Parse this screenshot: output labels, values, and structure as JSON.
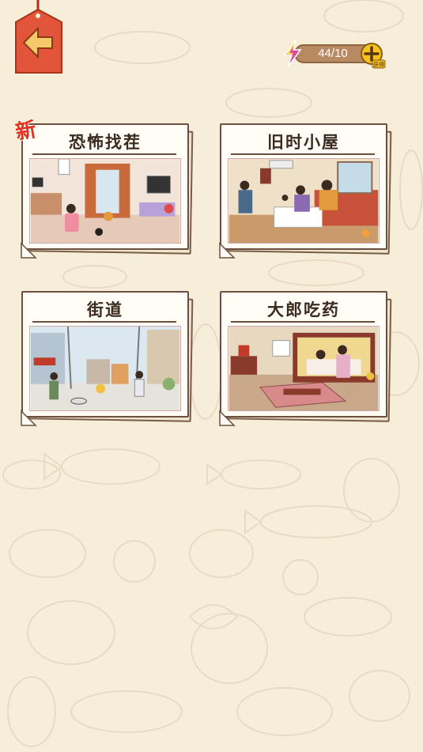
{
  "header": {
    "back_icon": "arrow-left-icon",
    "energy": {
      "value_text": "44/10",
      "icon": "lightning-icon",
      "plus_icon": "plus-icon",
      "plus_sub": "获得"
    }
  },
  "levels": [
    {
      "title": "恐怖找茬",
      "badge": "新",
      "scene": "girl-room-scene"
    },
    {
      "title": "旧时小屋",
      "badge": "",
      "scene": "old-house-scene"
    },
    {
      "title": "街道",
      "badge": "",
      "scene": "street-scene"
    },
    {
      "title": "大郎吃药",
      "badge": "",
      "scene": "bedroom-scene"
    }
  ],
  "colors": {
    "background": "#f7eed9",
    "back_button": "#e2553a",
    "energy_bar": "#b98a62",
    "plus_button": "#f5c31c",
    "new_badge": "#e2321f"
  }
}
